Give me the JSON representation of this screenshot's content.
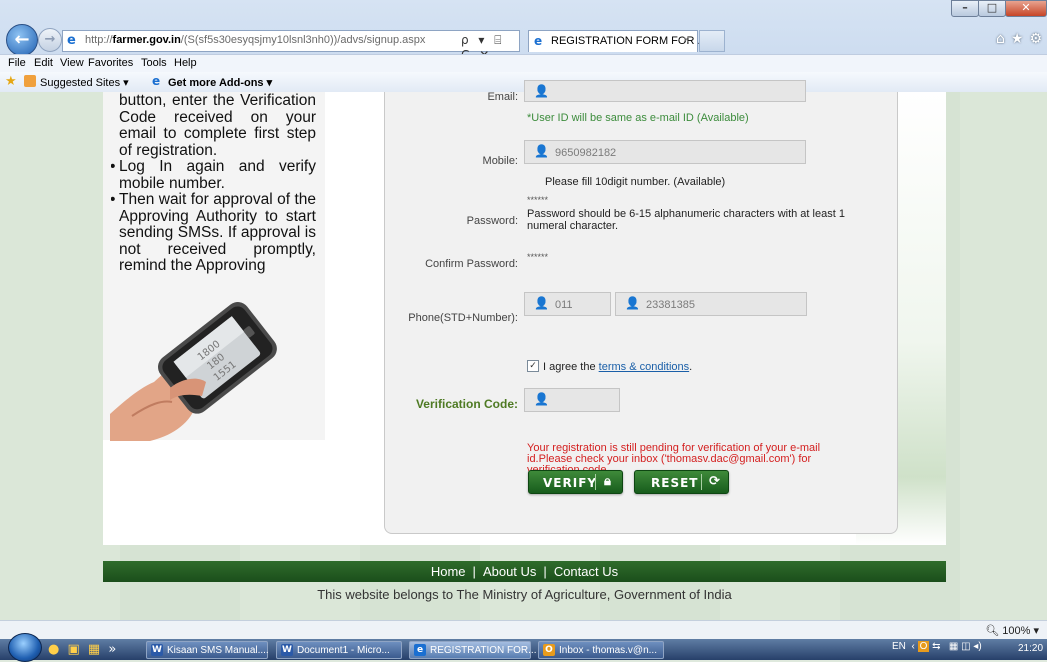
{
  "browser": {
    "url_prefix": "http://",
    "url_domain": "farmer.gov.in",
    "url_path": "/(S(sf5s30esyqsjmy10lsnl3nh0))/advs/signup.aspx",
    "address_tools": "ρ ▾ ⌸ C ✕",
    "tab_title": "REGISTRATION FORM FOR ...",
    "tab_close": "×",
    "menu": [
      "File",
      "Edit",
      "View",
      "Favorites",
      "Tools",
      "Help"
    ],
    "favorites": {
      "suggested": "Suggested Sites ▾",
      "addons": "Get more Add-ons ▾"
    },
    "window_buttons": [
      "–",
      "□",
      "✕"
    ],
    "right_icons": "⌂★⚙"
  },
  "sidebar": {
    "lines": [
      {
        "text": "button, enter the Verification Code received on your email to complete first step of registration.",
        "bullet": false
      },
      {
        "text": "Log In again and verify mobile number.",
        "bullet": true
      },
      {
        "text": "Then wait for approval of the Approving Authority to start sending SMSs. If approval is not received promptly, remind the Approving",
        "bullet": true
      }
    ]
  },
  "form": {
    "email_label": "Email:",
    "userid_note": "*User ID will be same as e-mail ID (Available)",
    "mobile_label": "Mobile:",
    "mobile_value": "9650982182",
    "mobile_note": "Please fill 10digit number. (Available)",
    "password_label": "Password:",
    "password_mask": "******",
    "password_note": "Password should be 6-15 alphanumeric characters with at least 1 numeral character.",
    "confirm_label": "Confirm Password:",
    "confirm_mask": "******",
    "phone_label": "Phone(STD+Number):",
    "std_value": "011",
    "number_value": "23381385",
    "agree_check": "✓",
    "agree_text": "I agree the ",
    "terms_text": "terms & conditions",
    "terms_after": ".",
    "verification_label": "Verification Code:",
    "verification_value": "",
    "pending_message": "Your registration is still pending for verification of your e-mail id.Please check your inbox ('thomasv.dac@gmail.com') for verification code.",
    "verify_button": "VERIFY",
    "reset_button": "RESET"
  },
  "footer": {
    "links": [
      "Home",
      "About Us",
      "Contact Us"
    ],
    "separator": "|",
    "note": "This website belongs to The Ministry of Agriculture, Government of India"
  },
  "statusbar": {
    "zoom": "100%"
  },
  "taskbar": {
    "quick_launch": "» ",
    "tasks": [
      {
        "label": "Kisaan SMS Manual....",
        "icon": "W",
        "icon_color": "#2b5aa8",
        "active": false
      },
      {
        "label": "Document1 - Micro...",
        "icon": "W",
        "icon_color": "#2b5aa8",
        "active": false
      },
      {
        "label": "REGISTRATION FOR...",
        "icon": "e",
        "icon_color": "#1a6fd1",
        "active": true
      },
      {
        "label": "Inbox - thomas.v@n...",
        "icon": "O",
        "icon_color": "#e79b1d",
        "active": false
      }
    ],
    "language": "EN",
    "clock": "21:20"
  },
  "colors": {
    "primary_green": "#1b4e1b",
    "label_green": "#4e7a23",
    "error_red": "#d42020",
    "link_blue": "#1a5fa8"
  }
}
